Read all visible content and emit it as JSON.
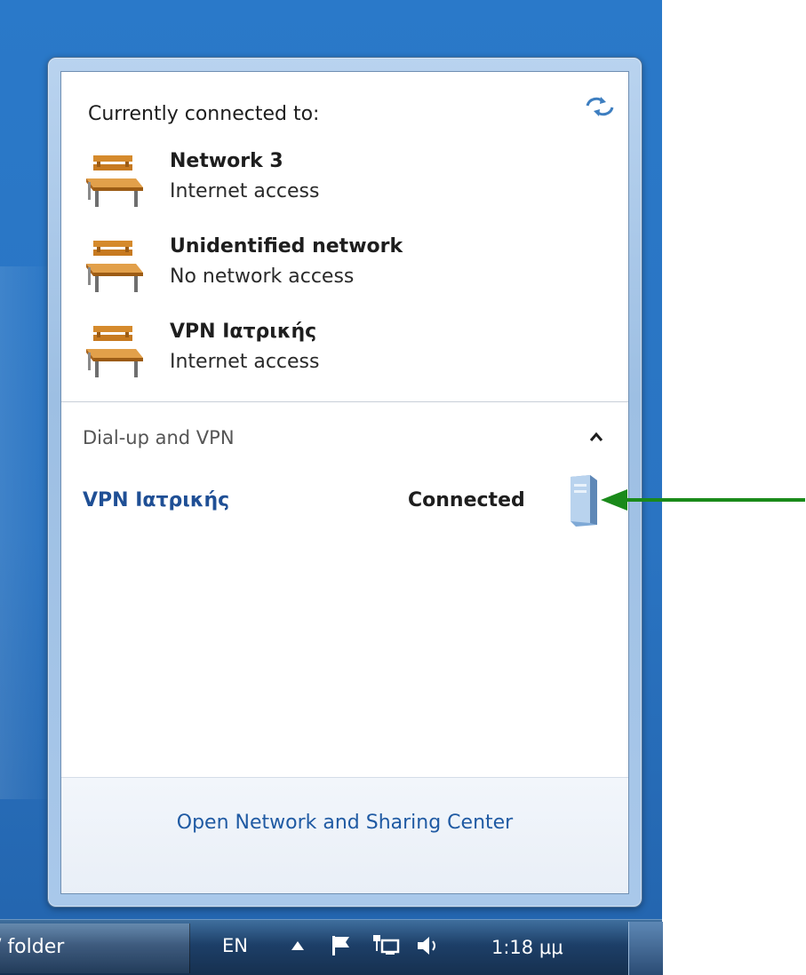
{
  "popup": {
    "header": "Currently connected to:",
    "refresh_icon": "network-refresh-icon",
    "networks": [
      {
        "name": "Network  3",
        "status": "Internet access",
        "icon": "bench-network-icon"
      },
      {
        "name": "Unidentified network",
        "status": "No network access",
        "icon": "bench-network-icon"
      },
      {
        "name": "VPN Ιατρικής",
        "status": "Internet access",
        "icon": "bench-network-icon"
      }
    ],
    "section": {
      "label": "Dial-up and VPN",
      "toggle_icon": "chevron-up-icon"
    },
    "vpn": {
      "name": "VPN Ιατρικής",
      "status": "Connected",
      "icon": "vpn-server-icon"
    },
    "footer_link": "Open Network and Sharing Center"
  },
  "annotation": {
    "arrow_color": "#1a8a1a",
    "icon": "green-arrow-icon"
  },
  "taskbar": {
    "button_label": "/ folder",
    "language": "EN",
    "clock": "1:18 μμ",
    "tray_icons": [
      "show-hidden-icons-icon",
      "action-center-flag-icon",
      "network-icon",
      "volume-icon"
    ]
  },
  "colors": {
    "link": "#1f5aa3",
    "vpn_name": "#1f4f95",
    "desktop": "#2a74c2"
  }
}
